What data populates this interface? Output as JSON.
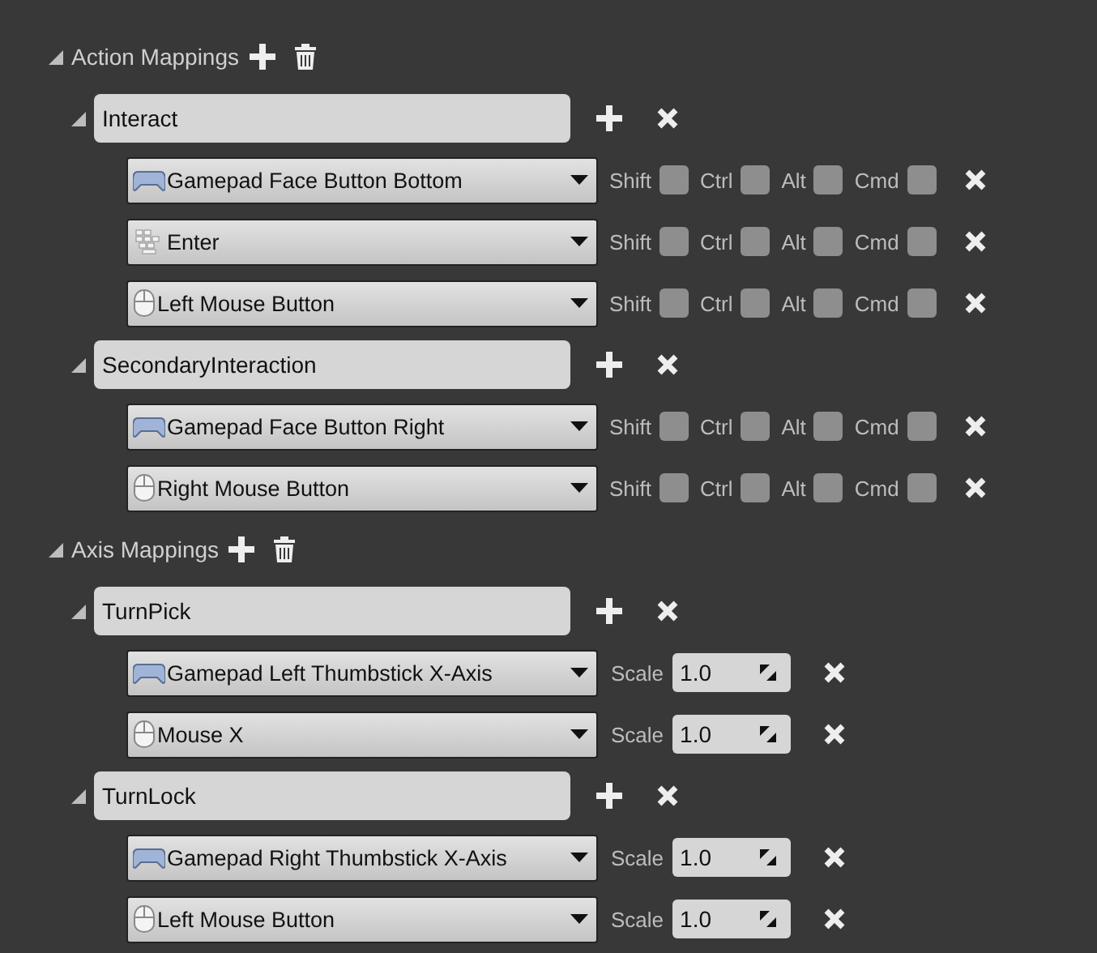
{
  "sections": [
    {
      "title": "Action Mappings",
      "kind": "action",
      "expanded": true,
      "mappings": [
        {
          "name": "Interact",
          "expanded": true,
          "keys": [
            {
              "key": "Gamepad Face Button Bottom",
              "kind": "gamepad",
              "modifiers": [
                {
                  "label": "Shift",
                  "checked": false
                },
                {
                  "label": "Ctrl",
                  "checked": false
                },
                {
                  "label": "Alt",
                  "checked": false
                },
                {
                  "label": "Cmd",
                  "checked": false
                }
              ]
            },
            {
              "key": "Enter",
              "kind": "keyboard",
              "modifiers": [
                {
                  "label": "Shift",
                  "checked": false
                },
                {
                  "label": "Ctrl",
                  "checked": false
                },
                {
                  "label": "Alt",
                  "checked": false
                },
                {
                  "label": "Cmd",
                  "checked": false
                }
              ]
            },
            {
              "key": "Left Mouse Button",
              "kind": "mouse",
              "modifiers": [
                {
                  "label": "Shift",
                  "checked": false
                },
                {
                  "label": "Ctrl",
                  "checked": false
                },
                {
                  "label": "Alt",
                  "checked": false
                },
                {
                  "label": "Cmd",
                  "checked": false
                }
              ]
            }
          ]
        },
        {
          "name": "SecondaryInteraction",
          "expanded": true,
          "keys": [
            {
              "key": "Gamepad Face Button Right",
              "kind": "gamepad",
              "modifiers": [
                {
                  "label": "Shift",
                  "checked": false
                },
                {
                  "label": "Ctrl",
                  "checked": false
                },
                {
                  "label": "Alt",
                  "checked": false
                },
                {
                  "label": "Cmd",
                  "checked": false
                }
              ]
            },
            {
              "key": "Right Mouse Button",
              "kind": "mouse",
              "modifiers": [
                {
                  "label": "Shift",
                  "checked": false
                },
                {
                  "label": "Ctrl",
                  "checked": false
                },
                {
                  "label": "Alt",
                  "checked": false
                },
                {
                  "label": "Cmd",
                  "checked": false
                }
              ]
            }
          ]
        }
      ]
    },
    {
      "title": "Axis Mappings",
      "kind": "axis",
      "expanded": true,
      "mappings": [
        {
          "name": "TurnPick",
          "expanded": true,
          "keys": [
            {
              "key": "Gamepad Left Thumbstick X-Axis",
              "kind": "gamepad",
              "scale_label": "Scale",
              "scale": "1.0"
            },
            {
              "key": "Mouse X",
              "kind": "mouse",
              "scale_label": "Scale",
              "scale": "1.0"
            }
          ]
        },
        {
          "name": "TurnLock",
          "expanded": true,
          "keys": [
            {
              "key": "Gamepad Right Thumbstick X-Axis",
              "kind": "gamepad",
              "scale_label": "Scale",
              "scale": "1.0"
            },
            {
              "key": "Left Mouse Button",
              "kind": "mouse",
              "scale_label": "Scale",
              "scale": "1.0"
            }
          ]
        }
      ]
    }
  ]
}
